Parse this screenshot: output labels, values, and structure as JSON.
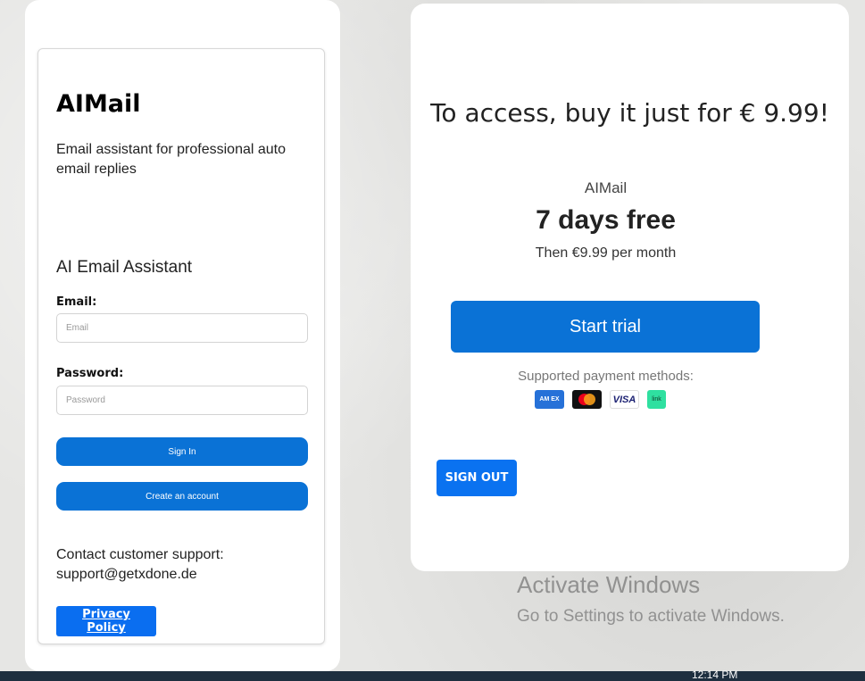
{
  "login": {
    "app_title": "AIMail",
    "app_description": "Email assistant for professional auto email replies",
    "section_title": "AI Email Assistant",
    "email_label": "Email:",
    "email_placeholder": "Email",
    "password_label": "Password:",
    "password_placeholder": "Password",
    "sign_in_label": "Sign In",
    "create_account_label": "Create an account",
    "contact_line1": "Contact customer support:",
    "contact_line2": "support@getxdone.de",
    "privacy_label": "Privacy Policy"
  },
  "pricing": {
    "headline": "To access, buy it just for € 9.99!",
    "product_name": "AIMail",
    "trial_title": "7 days free",
    "trial_subtitle": "Then €9.99 per month",
    "start_label": "Start trial",
    "payment_label": "Supported payment methods:",
    "payment_methods": [
      {
        "icon": "amex-icon",
        "text": "AM EX"
      },
      {
        "icon": "mastercard-icon",
        "text": ""
      },
      {
        "icon": "visa-icon",
        "text": "VISA"
      },
      {
        "icon": "link-icon",
        "text": "link"
      }
    ],
    "sign_out_label": "SIGN OUT"
  },
  "watermark": {
    "title": "Activate Windows",
    "subtitle": "Go to Settings to activate Windows."
  },
  "taskbar": {
    "time": "12:14 PM"
  },
  "colors": {
    "primary_button": "#0a72d6",
    "sign_out_button": "#0a72f0",
    "taskbar": "#1e2f3f"
  }
}
